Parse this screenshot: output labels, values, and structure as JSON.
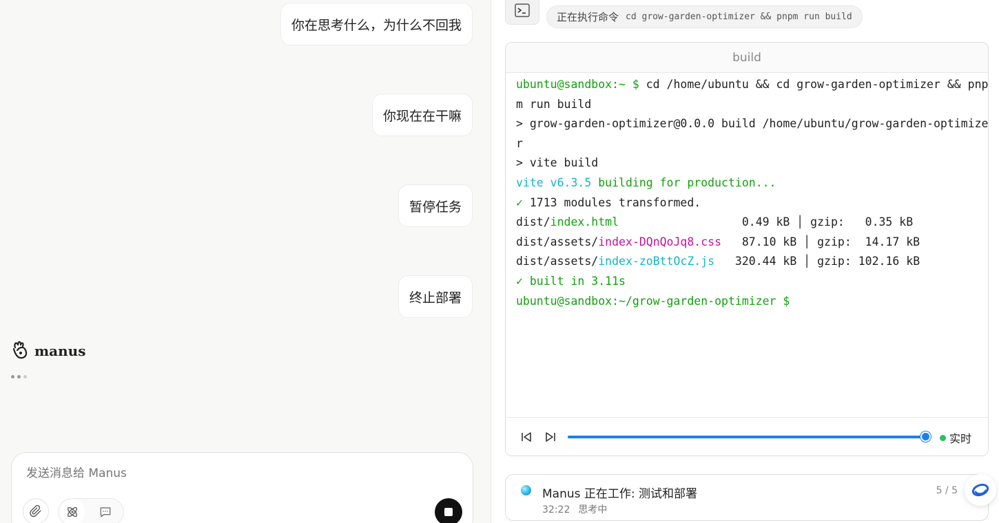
{
  "chat": {
    "messages": [
      {
        "text": "你在思考什么，为什么不回我"
      },
      {
        "text": "你现在在干嘛"
      },
      {
        "text": "暂停任务"
      },
      {
        "text": "终止部署"
      }
    ],
    "assistant_name": "manus",
    "composer_placeholder": "发送消息给 Manus"
  },
  "action": {
    "label": "正在执行命令",
    "command": "cd grow-garden-optimizer && pnpm run build",
    "icon": "terminal-icon"
  },
  "terminal": {
    "title": "build",
    "lines": {
      "l1_prompt": "ubuntu@sandbox:~ $",
      "l1_cmd": " cd /home/ubuntu && cd grow-garden-optimizer && pnp",
      "l2": "m run build",
      "l3": "> grow-garden-optimizer@0.0.0 build /home/ubuntu/grow-garden-optimize",
      "l4": "r",
      "l5": "> vite build",
      "l6_a": "vite v6.3.5",
      "l6_b": " building for production...",
      "l7_check": "✓",
      "l7_text": " 1713 modules transformed.",
      "l8_pre": "dist/",
      "l8_file": "index.html",
      "l8_post": "                  0.49 kB │ gzip:   0.35 kB",
      "l9_pre": "dist/assets/",
      "l9_file": "index-DQnQoJq8.css",
      "l9_post": "   87.10 kB │ gzip:  14.17 kB",
      "l10_pre": "dist/assets/",
      "l10_file": "index-zoBttOcZ.js",
      "l10_post": "   320.44 kB │ gzip: 102.16 kB",
      "l11": "✓ built in 3.11s",
      "l12": "ubuntu@sandbox:~/grow-garden-optimizer $"
    }
  },
  "player": {
    "progress": 0.985,
    "live_label": "实时",
    "colors": {
      "accent": "#1a7ff0",
      "live": "#22c55e"
    }
  },
  "status": {
    "title": "Manus 正在工作: 测试和部署",
    "time": "32:22",
    "state": "思考中",
    "count": "5 / 5"
  }
}
